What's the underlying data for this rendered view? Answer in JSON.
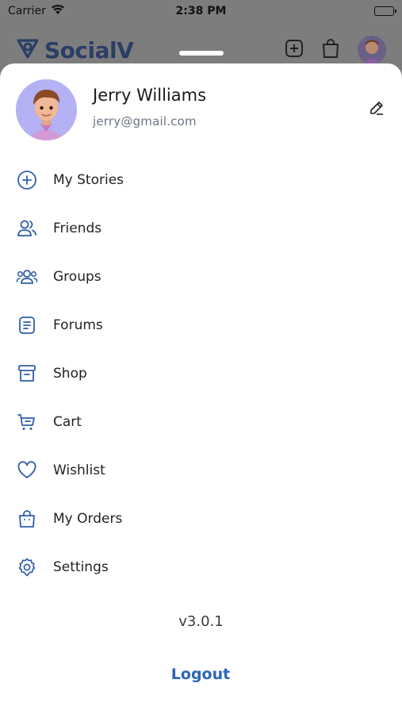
{
  "status_bar": {
    "carrier": "Carrier",
    "time": "2:38 PM"
  },
  "background_app": {
    "logo_text": "SocialV"
  },
  "profile": {
    "name": "Jerry Williams",
    "email": "jerry@gmail.com"
  },
  "menu": {
    "items": [
      {
        "label": "My Stories",
        "icon": "add-circle-icon"
      },
      {
        "label": "Friends",
        "icon": "friends-icon"
      },
      {
        "label": "Groups",
        "icon": "groups-icon"
      },
      {
        "label": "Forums",
        "icon": "forums-icon"
      },
      {
        "label": "Shop",
        "icon": "shop-icon"
      },
      {
        "label": "Cart",
        "icon": "cart-icon"
      },
      {
        "label": "Wishlist",
        "icon": "heart-icon"
      },
      {
        "label": "My Orders",
        "icon": "bag-icon"
      },
      {
        "label": "Settings",
        "icon": "gear-icon"
      }
    ]
  },
  "footer": {
    "version": "v3.0.1",
    "logout_label": "Logout"
  },
  "colors": {
    "accent": "#2b65b8",
    "icon": "#2f5fa8",
    "logo": "#2a3e66"
  }
}
